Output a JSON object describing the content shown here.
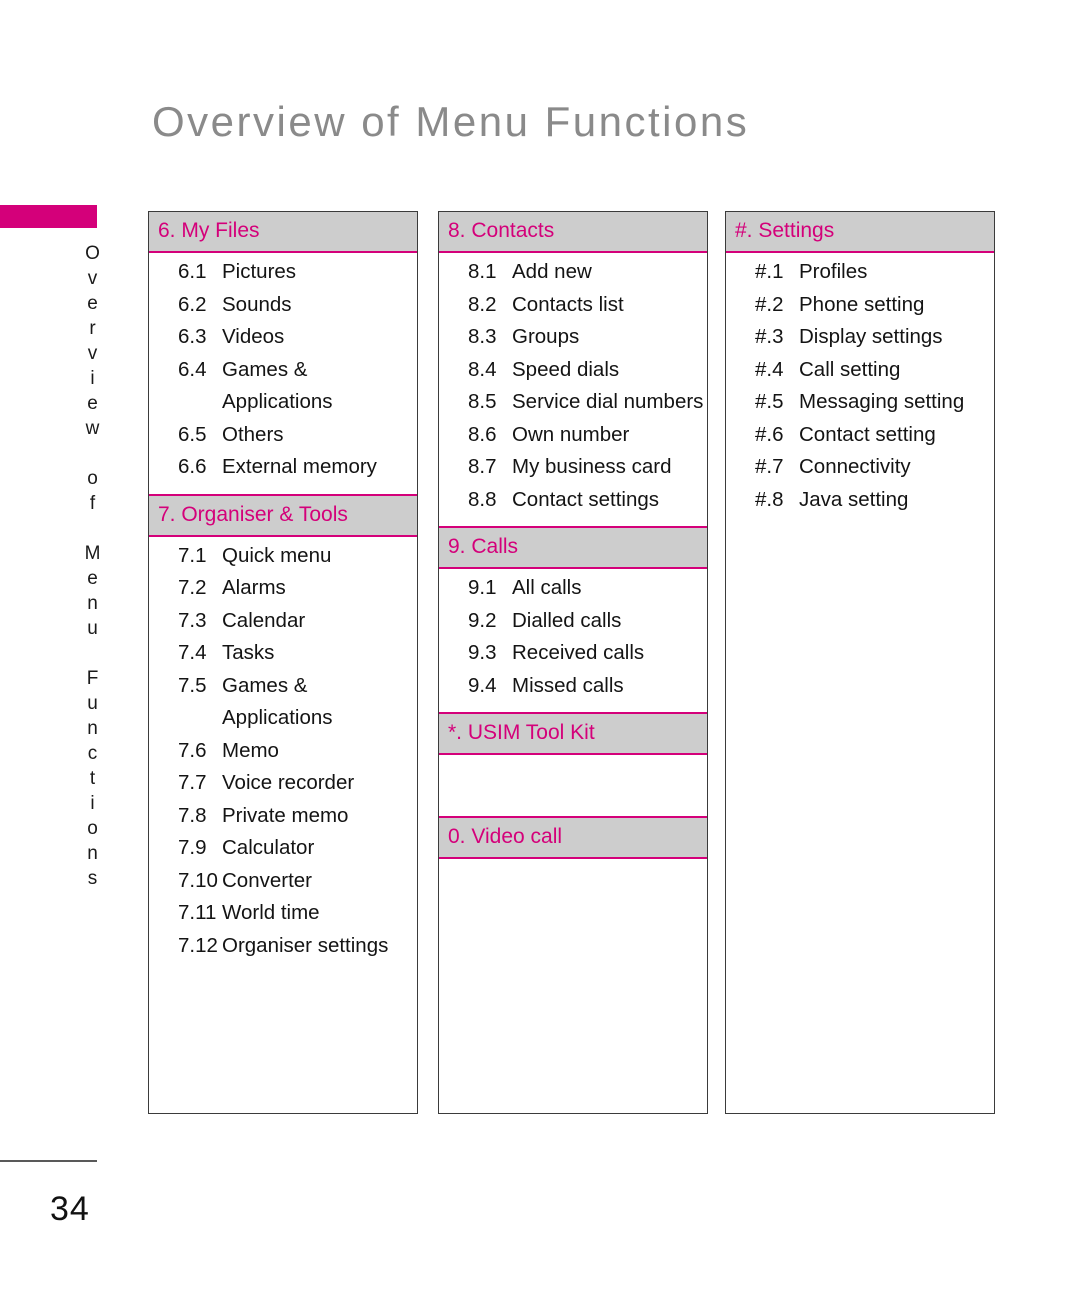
{
  "page": {
    "title": "Overview of Menu Functions",
    "side_label": "Overview of Menu Functions",
    "number": "34"
  },
  "columns": [
    {
      "name": "column-1",
      "sections": [
        {
          "header": "6. My Files",
          "items": [
            {
              "num": "6.1",
              "label": "Pictures"
            },
            {
              "num": "6.2",
              "label": "Sounds"
            },
            {
              "num": "6.3",
              "label": "Videos"
            },
            {
              "num": "6.4",
              "label": "Games &",
              "cont": "Applications"
            },
            {
              "num": "6.5",
              "label": "Others"
            },
            {
              "num": "6.6",
              "label": "External memory"
            }
          ]
        },
        {
          "header": "7. Organiser & Tools",
          "items": [
            {
              "num": "7.1",
              "label": "Quick menu"
            },
            {
              "num": "7.2",
              "label": "Alarms"
            },
            {
              "num": "7.3",
              "label": "Calendar"
            },
            {
              "num": "7.4",
              "label": "Tasks"
            },
            {
              "num": "7.5",
              "label": "Games &",
              "cont": "Applications"
            },
            {
              "num": "7.6",
              "label": "Memo"
            },
            {
              "num": "7.7",
              "label": "Voice recorder"
            },
            {
              "num": "7.8",
              "label": "Private memo"
            },
            {
              "num": "7.9",
              "label": "Calculator"
            },
            {
              "num": "7.10",
              "label": "Converter"
            },
            {
              "num": "7.11",
              "label": "World time"
            },
            {
              "num": "7.12",
              "label": "Organiser settings"
            }
          ]
        }
      ]
    },
    {
      "name": "column-2",
      "sections": [
        {
          "header": "8. Contacts",
          "items": [
            {
              "num": "8.1",
              "label": "Add new"
            },
            {
              "num": "8.2",
              "label": "Contacts list"
            },
            {
              "num": "8.3",
              "label": "Groups"
            },
            {
              "num": "8.4",
              "label": "Speed dials"
            },
            {
              "num": "8.5",
              "label": "Service dial numbers"
            },
            {
              "num": "8.6",
              "label": "Own number"
            },
            {
              "num": "8.7",
              "label": "My business card"
            },
            {
              "num": "8.8",
              "label": "Contact settings"
            }
          ]
        },
        {
          "header": "9. Calls",
          "items": [
            {
              "num": "9.1",
              "label": "All calls"
            },
            {
              "num": "9.2",
              "label": "Dialled calls"
            },
            {
              "num": "9.3",
              "label": "Received calls"
            },
            {
              "num": "9.4",
              "label": "Missed calls"
            }
          ]
        },
        {
          "header": "*. USIM Tool Kit",
          "items": []
        },
        {
          "header": "0. Video call",
          "items": []
        }
      ]
    },
    {
      "name": "column-3",
      "sections": [
        {
          "header": "#. Settings",
          "items": [
            {
              "num": "#.1",
              "label": "Profiles"
            },
            {
              "num": "#.2",
              "label": "Phone setting"
            },
            {
              "num": "#.3",
              "label": "Display settings"
            },
            {
              "num": "#.4",
              "label": "Call setting"
            },
            {
              "num": "#.5",
              "label": "Messaging setting"
            },
            {
              "num": "#.6",
              "label": "Contact setting"
            },
            {
              "num": "#.7",
              "label": "Connectivity"
            },
            {
              "num": "#.8",
              "label": "Java setting"
            }
          ]
        }
      ]
    }
  ],
  "colors": {
    "accent": "#d4007a",
    "header_background": "#cdcdcd",
    "title_gray": "#8a8a8a",
    "border": "#3b3b3b",
    "text": "#141414"
  }
}
